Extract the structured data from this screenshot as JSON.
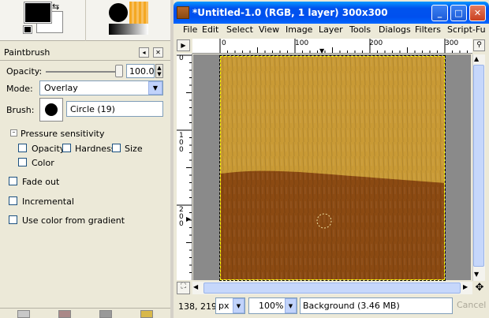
{
  "toolbox": {
    "tool_options_title": "Paintbrush",
    "opacity_label": "Opacity:",
    "opacity_value": "100.0",
    "opacity_level": 1.0,
    "mode_label": "Mode:",
    "mode_value": "Overlay",
    "brush_label": "Brush:",
    "brush_name": "Circle (19)",
    "pressure_label": "Pressure sensitivity",
    "pressure_opacity": "Opacity",
    "pressure_hardness": "Hardness",
    "pressure_size": "Size",
    "pressure_color": "Color",
    "fade_out": "Fade out",
    "incremental": "Incremental",
    "use_gradient": "Use color from gradient"
  },
  "window": {
    "title": "*Untitled-1.0 (RGB, 1 layer) 300x300",
    "minimize": "_",
    "maximize": "□",
    "close": "✕"
  },
  "menubar": [
    "File",
    "Edit",
    "Select",
    "View",
    "Image",
    "Layer",
    "Tools",
    "Dialogs",
    "Filters",
    "Script-Fu"
  ],
  "ruler": {
    "top_labels": [
      "0",
      "100",
      "200",
      "300"
    ],
    "left_labels": [
      "0",
      "100",
      "200"
    ]
  },
  "statusbar": {
    "coords": "138, 219",
    "unit": "px",
    "zoom": "100%",
    "message": "Background (3.46 MB)",
    "cancel": "Cancel"
  },
  "colors": {
    "image_top": "#c99a35",
    "image_bottom": "#8b4a12",
    "titlebar": "#0053ee"
  }
}
